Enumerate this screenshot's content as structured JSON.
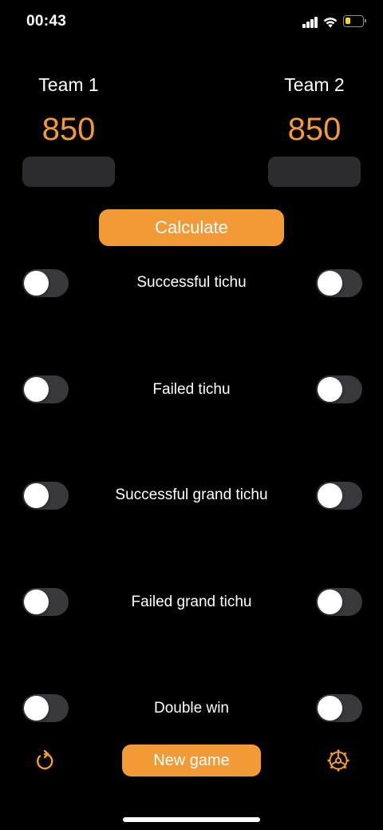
{
  "status_bar": {
    "time": "00:43",
    "icons": [
      "signal-icon",
      "wifi-icon",
      "battery-icon"
    ]
  },
  "teams": [
    {
      "name": "Team 1",
      "score": "850",
      "input_value": ""
    },
    {
      "name": "Team 2",
      "score": "850",
      "input_value": ""
    }
  ],
  "calculate_label": "Calculate",
  "options": [
    {
      "label": "Successful tichu",
      "team1_on": false,
      "team2_on": false
    },
    {
      "label": "Failed tichu",
      "team1_on": false,
      "team2_on": false
    },
    {
      "label": "Successful grand tichu",
      "team1_on": false,
      "team2_on": false
    },
    {
      "label": "Failed grand tichu",
      "team1_on": false,
      "team2_on": false
    },
    {
      "label": "Double win",
      "team1_on": false,
      "team2_on": false
    }
  ],
  "bottom_bar": {
    "new_game_label": "New game",
    "left_icon": "undo-icon",
    "right_icon": "settings-icon"
  },
  "colors": {
    "accent": "#f29a37",
    "background": "#000000",
    "field": "#2c2c2e",
    "toggle_off": "#39393d"
  }
}
